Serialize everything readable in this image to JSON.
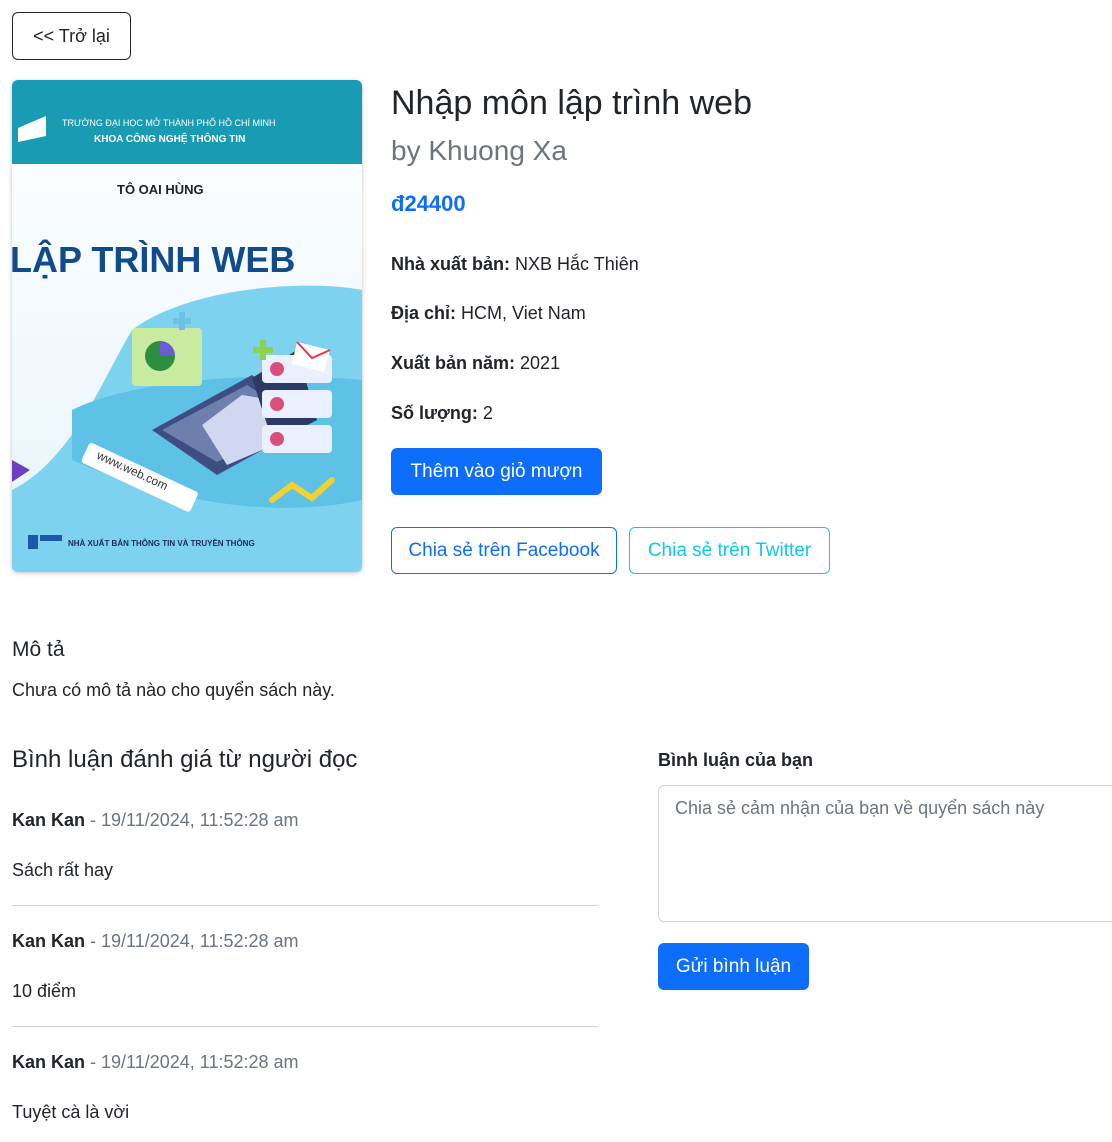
{
  "back_label": "<< Trở lại",
  "book": {
    "title": "Nhập môn lập trình web",
    "author": "by Khuong Xa",
    "price": "đ24400",
    "publisher_label": "Nhà xuất bản:",
    "publisher": "NXB Hắc Thiên",
    "address_label": "Địa chỉ:",
    "address": "HCM, Viet Nam",
    "year_label": "Xuất bản năm:",
    "year": "2021",
    "quantity_label": "Số lượng:",
    "quantity": "2"
  },
  "cover": {
    "university": "TRƯỜNG ĐẠI HỌC MỞ THÀNH PHỐ HỒ CHÍ MINH",
    "faculty": "KHOA CÔNG NGHỆ THÔNG TIN",
    "author_name": "TÔ OAI HÙNG",
    "big_title": "LẬP TRÌNH WEB",
    "url_text": "www.web.com",
    "publisher_line": "NHÀ XUẤT BẢN THÔNG TIN VÀ TRUYỀN THÔNG"
  },
  "actions": {
    "add_to_cart": "Thêm vào giỏ mượn",
    "share_facebook": "Chia sẻ trên Facebook",
    "share_twitter": "Chia sẻ trên Twitter"
  },
  "description": {
    "title": "Mô tả",
    "text": "Chưa có mô tả nào cho quyển sách này."
  },
  "reviews": {
    "title": "Bình luận đánh giá từ người đọc",
    "items": [
      {
        "name": "Kan Kan",
        "date": " - 19/11/2024, 11:52:28 am",
        "text": "Sách rất hay"
      },
      {
        "name": "Kan Kan",
        "date": " - 19/11/2024, 11:52:28 am",
        "text": "10 điểm"
      },
      {
        "name": "Kan Kan",
        "date": " - 19/11/2024, 11:52:28 am",
        "text": "Tuyệt cà là vời"
      }
    ]
  },
  "comment_form": {
    "label": "Bình luận của bạn",
    "placeholder": "Chia sẻ cảm nhận của bạn về quyển sách này",
    "submit": "Gửi bình luận"
  },
  "colors": {
    "primary": "#0d6efd",
    "info": "#0dcaf0",
    "cover_band": "#1a9bb4"
  }
}
